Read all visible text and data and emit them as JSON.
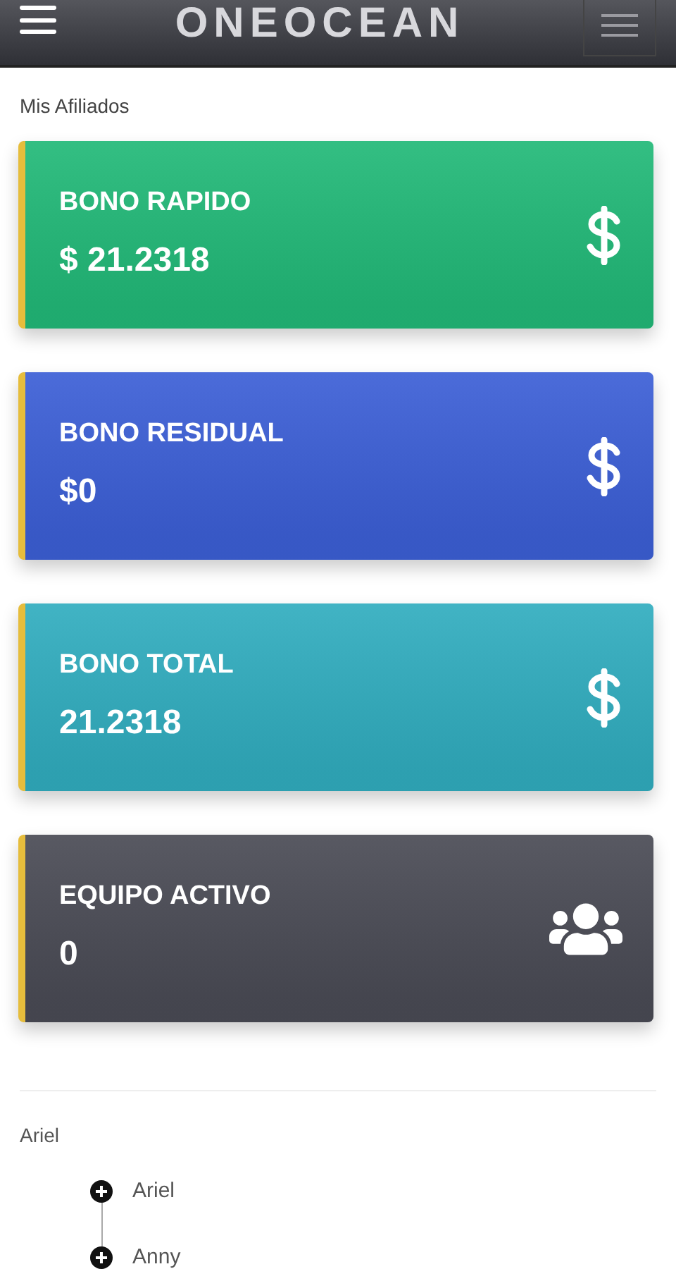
{
  "header": {
    "logo": "ONEOCEAN"
  },
  "section_title": "Mis Afiliados",
  "cards": [
    {
      "label": "BONO RAPIDO",
      "value": "$ 21.2318",
      "color": "#22b978",
      "kind": "dollar"
    },
    {
      "label": "BONO RESIDUAL",
      "value": "$0",
      "color": "#3c5fd6",
      "kind": "dollar"
    },
    {
      "label": "BONO TOTAL",
      "value": "21.2318",
      "color": "#31adbf",
      "kind": "dollar"
    },
    {
      "label": "EQUIPO ACTIVO",
      "value": "0",
      "color": "#4a4b55",
      "kind": "users"
    }
  ],
  "tree": {
    "root": "Ariel",
    "children": [
      {
        "name": "Ariel"
      },
      {
        "name": "Anny"
      }
    ]
  }
}
